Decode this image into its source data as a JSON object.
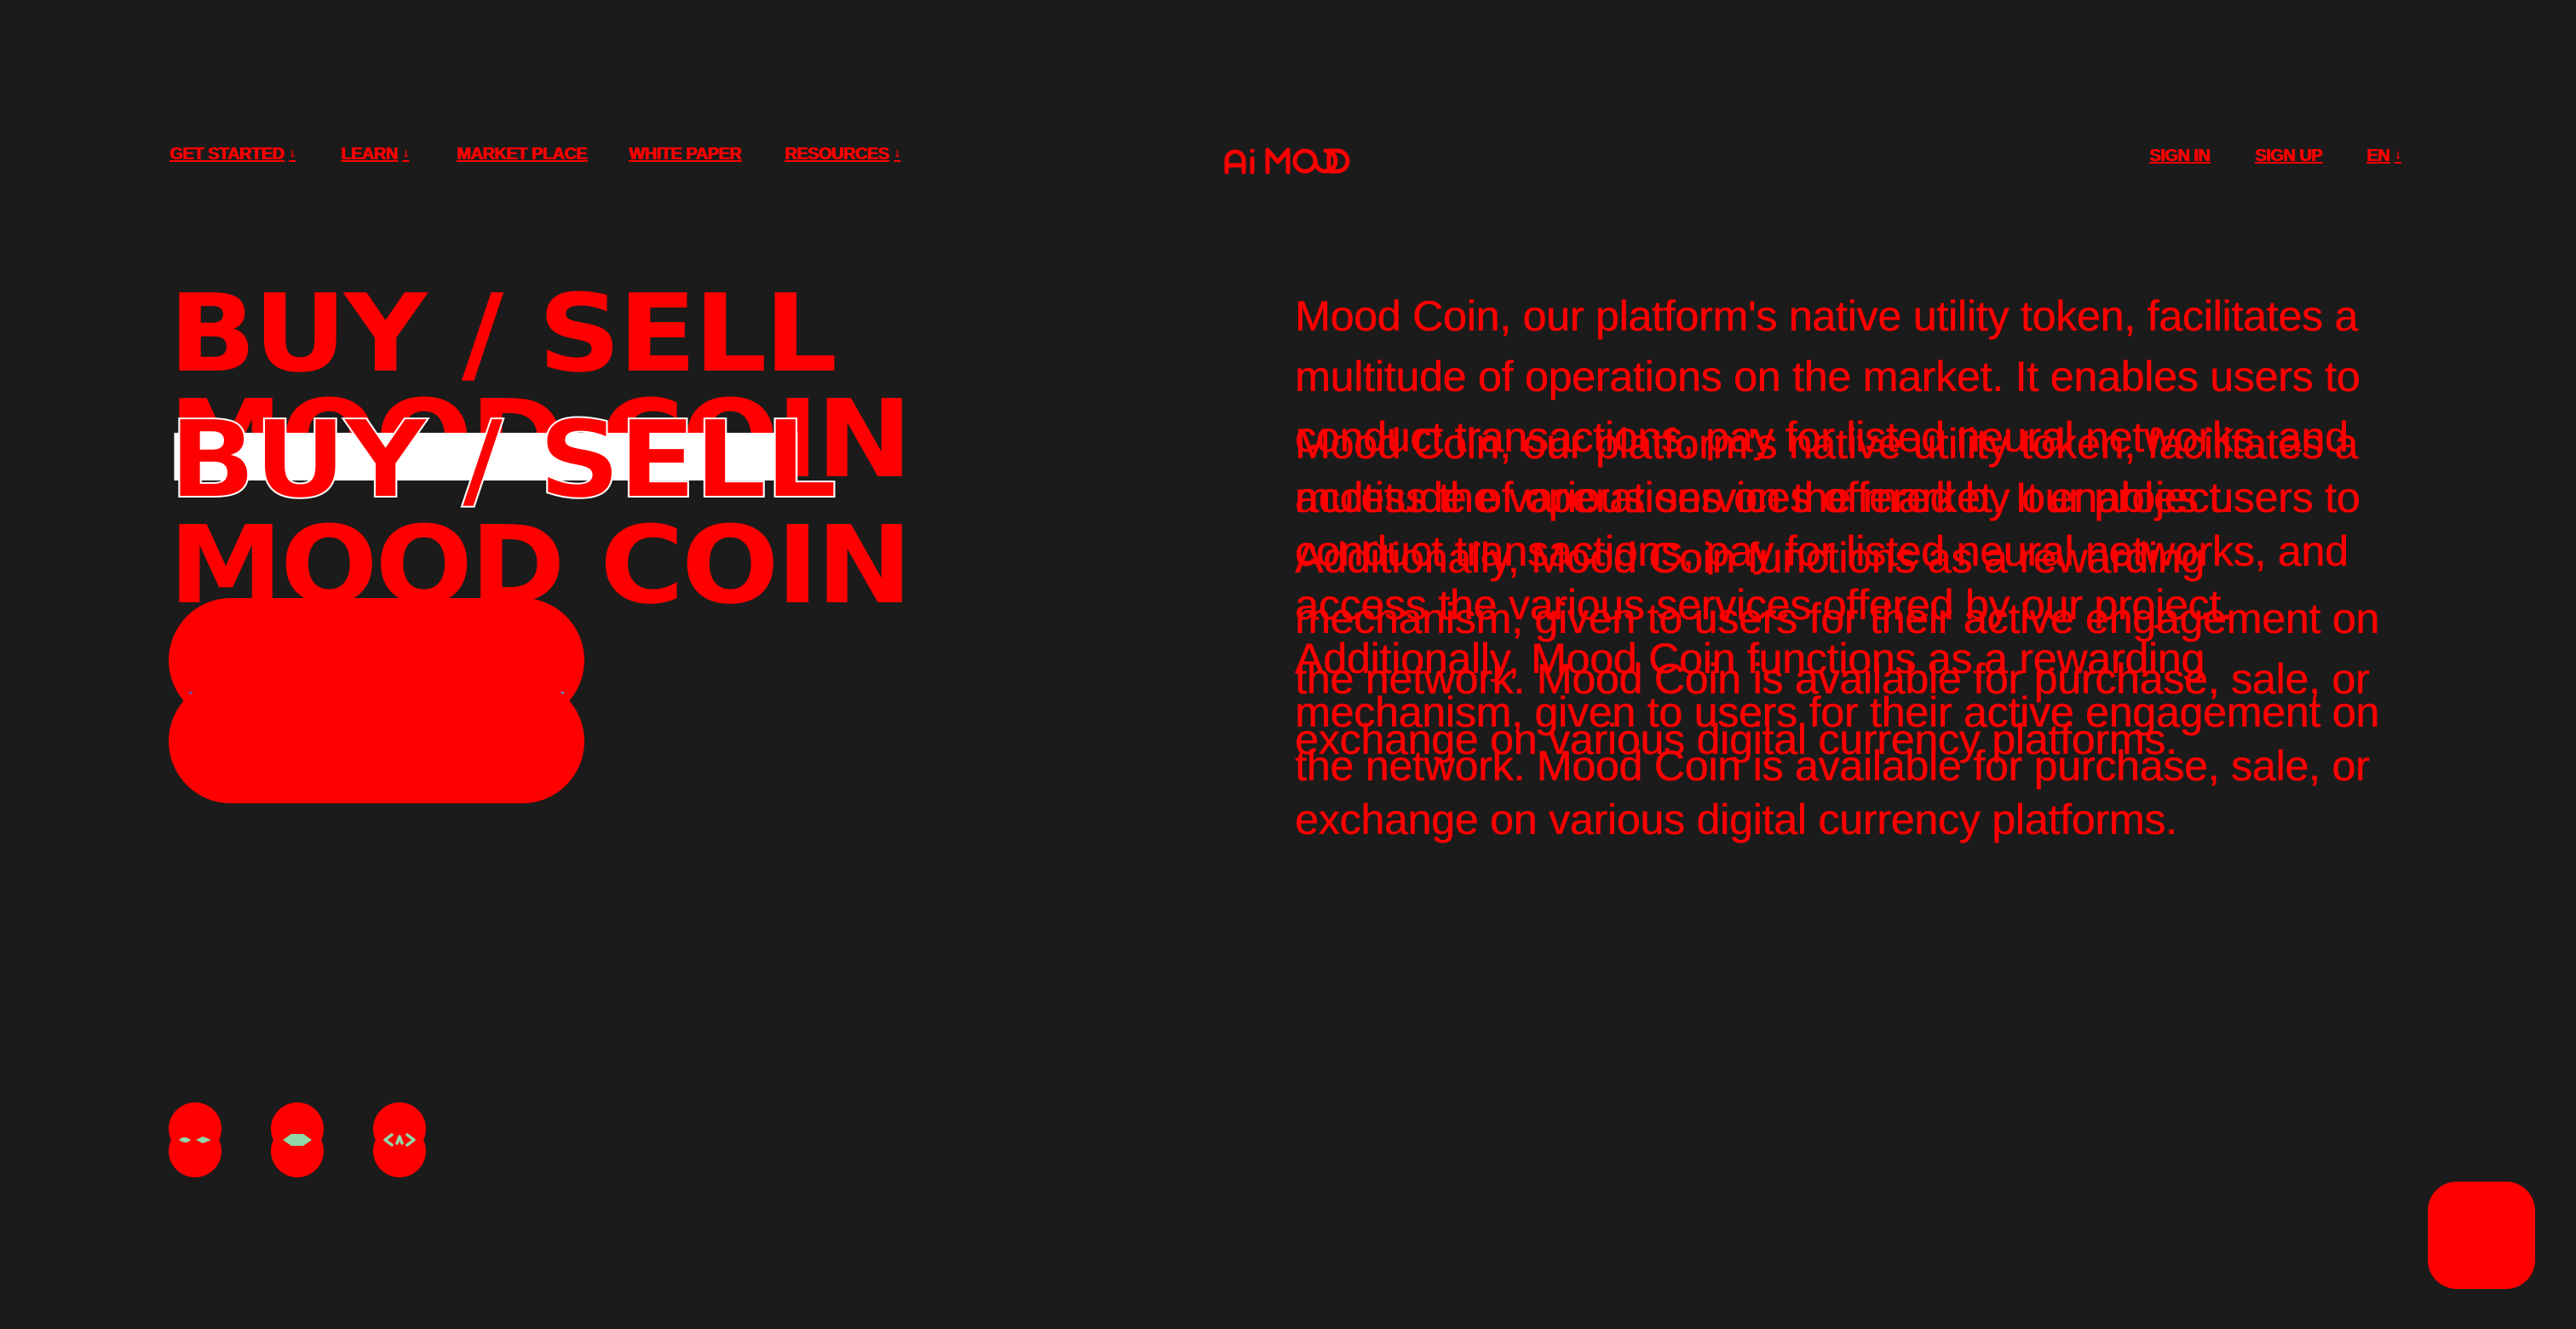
{
  "header": {
    "nav": [
      {
        "label": "GET STARTED",
        "has_dropdown": true
      },
      {
        "label": "LEARN",
        "has_dropdown": true
      },
      {
        "label": "MARKET PLACE",
        "has_dropdown": false
      },
      {
        "label": "WHITE PAPER",
        "has_dropdown": false
      },
      {
        "label": "RESOURCES",
        "has_dropdown": true
      }
    ],
    "caret": "↓",
    "logo_icon": "ai-mood-logo",
    "right": {
      "sign_in": "SIGN IN",
      "sign_up": "SIGN UP",
      "language": "EN"
    }
  },
  "hero": {
    "heading_line1": "BUY / SELL",
    "heading_line2": "MOOD COIN",
    "description": "Mood Coin, our platform's native utility token, facilitates a multitude of operations on the market. It enables users to conduct transactions, pay for listed neural networks, and access the various services offered by our project. Additionally, Mood Coin functions as a rewarding mechanism, given to users for their active engagement on the network. Mood Coin is available for purchase, sale, or exchange on various digital currency platforms."
  },
  "social": [
    {
      "icon": "social-link-icon-1"
    },
    {
      "icon": "social-link-icon-2"
    },
    {
      "icon": "social-link-icon-3"
    }
  ],
  "colors": {
    "background": "#1b1b1b",
    "accent": "#ff0000",
    "button_blue": "#3b7eed",
    "icon_green": "#8fd9a8",
    "white": "#ffffff"
  }
}
